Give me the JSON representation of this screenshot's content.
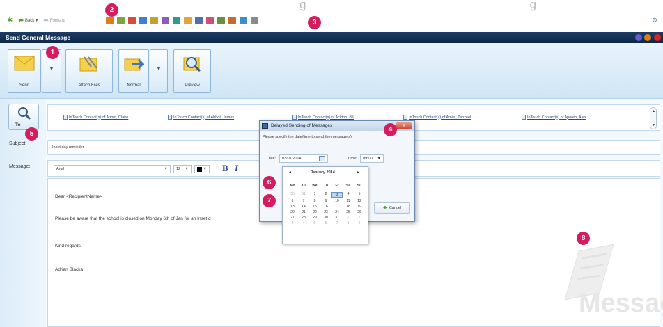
{
  "top_banner_text": "g                                                                    g",
  "nav": {
    "back": "Back",
    "forward": "Forward"
  },
  "toolbar_icon_colors": [
    "#e07b1a",
    "#7aa63b",
    "#d64b3a",
    "#3f7fcf",
    "#c3a12a",
    "#8b5db8",
    "#2b9a8f",
    "#e0a43a",
    "#5070b0",
    "#cf4f7a",
    "#6b8f3a",
    "#c46d2a",
    "#3a8fc8",
    "#8a8a8a"
  ],
  "window": {
    "title": "Send General Message"
  },
  "ribbon": {
    "send": "Send",
    "attach": "Attach Files",
    "normal": "Normal",
    "preview": "Preview"
  },
  "to_button": "To",
  "contacts": [
    "InTouch Contact(s) of Abbot, Claire",
    "InTouch Contact(s) of Abbot, James",
    "InTouch Contact(s) of Ackton, Bill",
    "InTouch Contact(s) of Amiel, Tanzeel",
    "InTouch Contact(s) of Aperen, Alex"
  ],
  "subject": {
    "label": "Subject:",
    "value": "Inset day reminder"
  },
  "message": {
    "label": "Message:",
    "font": "Arial",
    "size": "12",
    "bold": "B",
    "italic": "I",
    "body": {
      "greeting": "Dear <RecipientName>",
      "line1": "Please be aware that the school is closed on Monday 6th of Jan for an Inset d",
      "closing": "Kind regards,",
      "signature": "Adrian Blacka"
    }
  },
  "dialog": {
    "title": "Delayed Sending of Messages",
    "close": "x",
    "instruction": "Please specify the date/time to send the message(s):",
    "date_label": "Date:",
    "date_value": "03/01/2014",
    "time_label": "Time:",
    "time_value": "09:00",
    "cancel": "Cancel"
  },
  "calendar": {
    "month": "January 2014",
    "prev": "◄",
    "next": "►",
    "weekdays": [
      "Mo",
      "Tu",
      "We",
      "Th",
      "Fr",
      "Sa",
      "Su"
    ],
    "days": [
      "30",
      "31",
      "1",
      "2",
      "3",
      "4",
      "5",
      "6",
      "7",
      "8",
      "9",
      "10",
      "11",
      "12",
      "13",
      "14",
      "15",
      "16",
      "17",
      "18",
      "19",
      "20",
      "21",
      "22",
      "23",
      "24",
      "25",
      "26",
      "27",
      "28",
      "29",
      "30",
      "31",
      "1",
      "2",
      "3",
      "4",
      "5",
      "6",
      "7",
      "8",
      "9"
    ],
    "selected": "3"
  },
  "badges": [
    "1",
    "2",
    "3",
    "4",
    "5",
    "6",
    "7",
    "8"
  ],
  "watermark": "Message",
  "colors": {
    "titlebar": "#1d3d66",
    "badge": "#d51c5f",
    "link": "#2a4d8a"
  }
}
